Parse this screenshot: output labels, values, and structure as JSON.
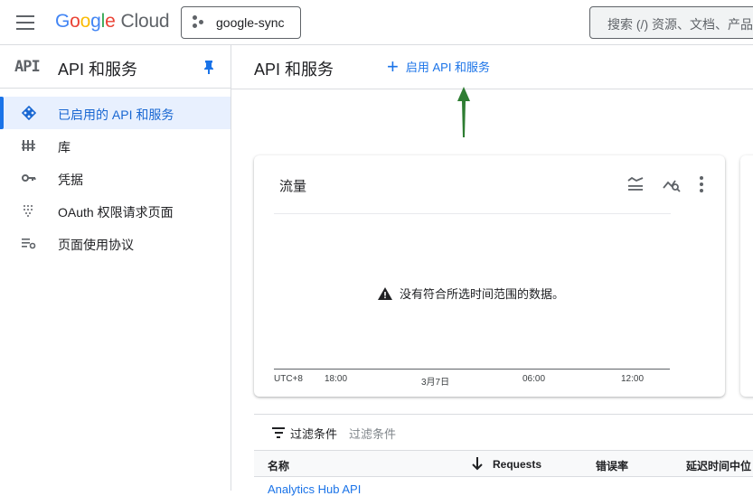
{
  "topbar": {
    "logo_letters": [
      "G",
      "o",
      "o",
      "g",
      "l",
      "e"
    ],
    "logo_cloud": "Cloud",
    "project_name": "google-sync",
    "search_placeholder": "搜索 (/) 资源、文档、产品"
  },
  "sidebar": {
    "logo_text": "API",
    "title": "API 和服务",
    "items": [
      {
        "label": "已启用的 API 和服务",
        "icon": "api-diamond-icon",
        "active": true
      },
      {
        "label": "库",
        "icon": "library-icon",
        "active": false
      },
      {
        "label": "凭据",
        "icon": "key-icon",
        "active": false
      },
      {
        "label": "OAuth 权限请求页面",
        "icon": "oauth-dots-icon",
        "active": false
      },
      {
        "label": "页面使用协议",
        "icon": "settings-list-icon",
        "active": false
      }
    ]
  },
  "main": {
    "title": "API 和服务",
    "enable_button": "启用 API 和服务"
  },
  "traffic_card": {
    "title": "流量",
    "no_data_message": "没有符合所选时间范围的数据。",
    "ticks": [
      "UTC+8",
      "18:00",
      "3月7日",
      "06:00",
      "12:00"
    ]
  },
  "filter": {
    "label": "过滤条件",
    "placeholder": "过滤条件"
  },
  "table": {
    "columns": [
      "名称",
      "Requests",
      "错误率",
      "延迟时间中位"
    ],
    "rows": [
      {
        "name": "Analytics Hub API"
      }
    ]
  },
  "colors": {
    "accent": "#1a73e8",
    "active_bg": "#e8f0fe",
    "annotation_arrow": "#2e7d32"
  }
}
